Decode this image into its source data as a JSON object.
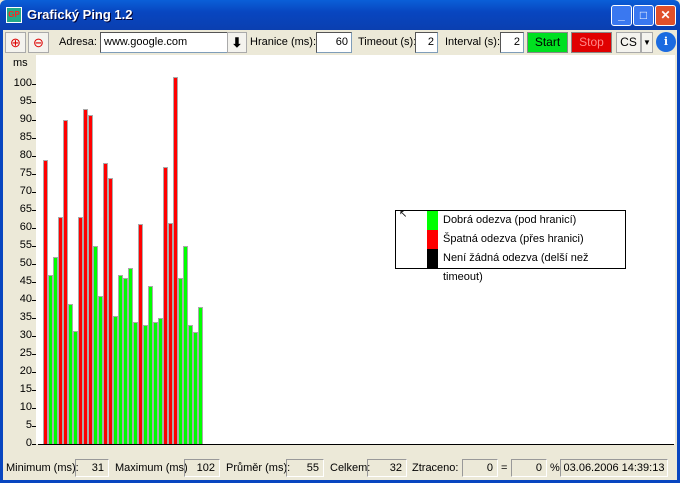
{
  "window": {
    "title": "Grafický Ping 1.2",
    "icon_text": "GP"
  },
  "toolbar": {
    "address_label": "Adresa:",
    "address_value": "www.google.com",
    "limit_label": "Hranice (ms):",
    "limit_value": "60",
    "timeout_label": "Timeout (s):",
    "timeout_value": "2",
    "interval_label": "Interval (s):",
    "interval_value": "2",
    "start_label": "Start",
    "stop_label": "Stop",
    "language": "CS"
  },
  "colors": {
    "good": "#00ff00",
    "bad": "#ff0000",
    "none": "#000000"
  },
  "chart_data": {
    "type": "bar",
    "ylabel": "ms",
    "ylim": [
      0,
      100
    ],
    "yticks": [
      0,
      5,
      10,
      15,
      20,
      25,
      30,
      35,
      40,
      45,
      50,
      55,
      60,
      65,
      70,
      75,
      80,
      85,
      90,
      95,
      100
    ],
    "threshold": 60,
    "values": [
      79,
      47,
      52,
      63,
      90,
      39,
      31.5,
      63,
      93,
      91.5,
      55,
      41,
      78,
      74,
      35.5,
      47,
      46,
      49,
      34,
      61,
      33,
      44,
      34,
      35,
      77,
      61.5,
      102,
      46,
      55,
      33,
      31,
      38
    ],
    "legend": [
      {
        "label": "Dobrá odezva (pod hranicí)",
        "color": "#00ff00"
      },
      {
        "label": "Špatná odezva (přes hranici)",
        "color": "#ff0000"
      },
      {
        "label": "Není žádná odezva (delší než timeout)",
        "color": "#000000"
      }
    ]
  },
  "status": {
    "min_label": "Minimum (ms):",
    "min": "31",
    "max_label": "Maximum (ms)",
    "max": "102",
    "avg_label": "Průměr (ms):",
    "avg": "55",
    "total_label": "Celkem:",
    "total": "32",
    "lost_label": "Ztraceno:",
    "lost": "0",
    "eq": "=",
    "lost_pct": "0",
    "pct": "%",
    "datetime": "03.06.2006 14:39:13"
  }
}
